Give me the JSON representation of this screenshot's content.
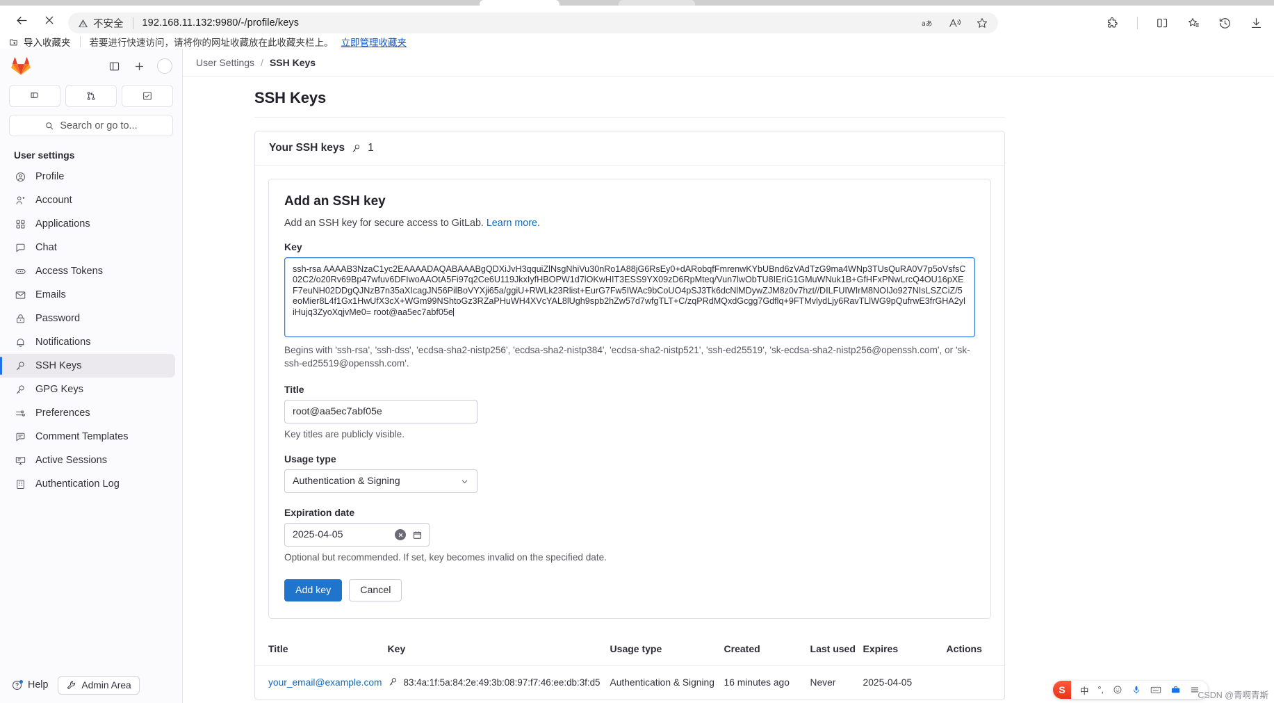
{
  "browser": {
    "back_label": "back",
    "stop_label": "stop",
    "security_label": "不安全",
    "url": "192.168.11.132:9980/-/profile/keys",
    "toolbar_icons": [
      "translate-icon",
      "read-aloud-icon",
      "favorite-star-icon",
      "extensions-icon",
      "split-screen-icon",
      "collections-icon",
      "history-icon",
      "downloads-icon"
    ],
    "bookmarks": {
      "import_label": "导入收藏夹",
      "note": "若要进行快速访问，请将你的网址收藏放在此收藏夹栏上。",
      "manage_link": "立即管理收藏夹"
    }
  },
  "sidebar": {
    "logo_name": "gitlab-logo",
    "toggle_label": "toggle-sidebar",
    "create_label": "create-new",
    "avatar_label": "user-avatar",
    "tiles": [
      "issues-icon",
      "merge-requests-icon",
      "todos-icon"
    ],
    "search_placeholder": "Search or go to...",
    "section_title": "User settings",
    "items": [
      {
        "label": "Profile",
        "icon": "profile-icon",
        "active": false
      },
      {
        "label": "Account",
        "icon": "account-icon",
        "active": false
      },
      {
        "label": "Applications",
        "icon": "applications-icon",
        "active": false
      },
      {
        "label": "Chat",
        "icon": "chat-icon",
        "active": false
      },
      {
        "label": "Access Tokens",
        "icon": "access-tokens-icon",
        "active": false
      },
      {
        "label": "Emails",
        "icon": "emails-icon",
        "active": false
      },
      {
        "label": "Password",
        "icon": "password-lock-icon",
        "active": false
      },
      {
        "label": "Notifications",
        "icon": "notifications-bell-icon",
        "active": false
      },
      {
        "label": "SSH Keys",
        "icon": "ssh-key-icon",
        "active": true
      },
      {
        "label": "GPG Keys",
        "icon": "gpg-key-icon",
        "active": false
      },
      {
        "label": "Preferences",
        "icon": "preferences-sliders-icon",
        "active": false
      },
      {
        "label": "Comment Templates",
        "icon": "comment-templates-icon",
        "active": false
      },
      {
        "label": "Active Sessions",
        "icon": "active-sessions-icon",
        "active": false
      },
      {
        "label": "Authentication Log",
        "icon": "authentication-log-icon",
        "active": false
      }
    ],
    "footer": {
      "help_label": "Help",
      "admin_label": "Admin Area"
    }
  },
  "breadcrumb": {
    "parent": "User Settings",
    "separator": "/",
    "current": "SSH Keys"
  },
  "page": {
    "title": "SSH Keys",
    "card_title": "Your SSH keys",
    "key_count": "1"
  },
  "form": {
    "heading": "Add an SSH key",
    "description_prefix": "Add an SSH key for secure access to GitLab. ",
    "description_link": "Learn more",
    "description_suffix": ".",
    "key_label": "Key",
    "key_value": "ssh-rsa AAAAB3NzaC1yc2EAAAADAQABAAABgQDXiJvH3qquiZlNsgNhiVu30nRo1A88jG6RsEy0+dARobqfFmrenwKYbUBnd6zVAdTzG9ma4WNp3TUsQuRA0V7p5oVsfsC02C2/o20Rv69Bp47wfuv6DFIwoAAOtA5Fi97q2Ce6U119JkxIyfHBOPW1d7lOKwHIT3ESS9YX09zD6RpMteq/Vun7lwObTU8IEriG1GMuWNuk1B+GfHFxPNwLrcQ4OU16pXEF7euNH02DDgQJNzB7n35aXIcagJN56PilBoVYXji65a/ggiU+RWLk23Rlist+EurG7Fw5IWAc9bCoUO4pSJ3Tk6dcNlMDywZJM8z0v7hzt//DILFUIWIrM8NOIJo927NIsLSZCiZ/5eoMier8L4f1Gx1HwUfX3cX+WGm99NShtoGz3RZaPHuWH4XVcYAL8lUgh9spb2hZw57d7wfgTLT+C/zqPRdMQxdGcgg7Gdflq+9FTMvlydLjy6RavTLlWG9pQufrwE3frGHA2yliHujq3ZyoXqjvMe0= root@aa5ec7abf05e",
    "key_hint": "Begins with 'ssh-rsa', 'ssh-dss', 'ecdsa-sha2-nistp256', 'ecdsa-sha2-nistp384', 'ecdsa-sha2-nistp521', 'ssh-ed25519', 'sk-ecdsa-sha2-nistp256@openssh.com', or 'sk-ssh-ed25519@openssh.com'.",
    "title_label": "Title",
    "title_value": "root@aa5ec7abf05e",
    "title_hint": "Key titles are publicly visible.",
    "usage_label": "Usage type",
    "usage_value": "Authentication & Signing",
    "expiration_label": "Expiration date",
    "expiration_value": "2025-04-05",
    "expiration_hint": "Optional but recommended. If set, key becomes invalid on the specified date.",
    "submit_label": "Add key",
    "cancel_label": "Cancel"
  },
  "table": {
    "headers": {
      "title": "Title",
      "key": "Key",
      "usage_type": "Usage type",
      "created": "Created",
      "last_used": "Last used",
      "expires": "Expires",
      "actions": "Actions"
    },
    "rows": [
      {
        "title": "your_email@example.com",
        "fingerprint": "83:4a:1f:5a:84:2e:49:3b:08:97:f7:46:ee:db:3f:d5",
        "usage_type": "Authentication & Signing",
        "created": "16 minutes ago",
        "last_used": "Never",
        "expires": "2025-04-05"
      }
    ]
  },
  "ime": {
    "logo": "S",
    "mode": "中",
    "items": [
      "voice-icon",
      "emoji-icon",
      "clipboard-icon",
      "keyboard-icon",
      "toolbox-icon",
      "menu-icon"
    ]
  },
  "watermark": "CSDN @青啊青斯"
}
